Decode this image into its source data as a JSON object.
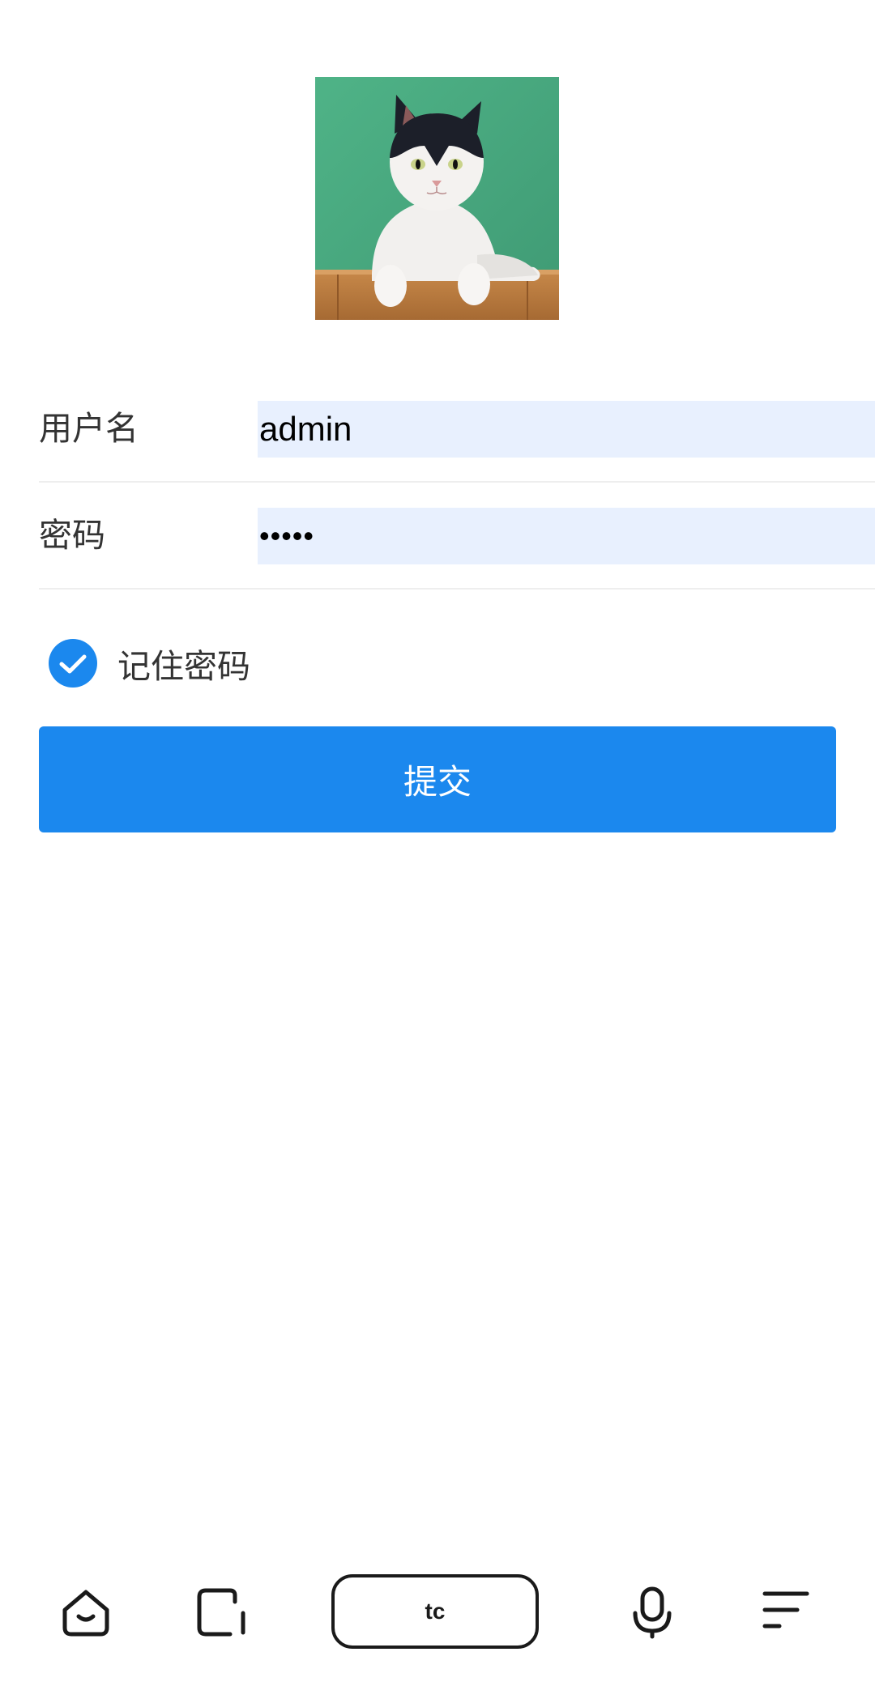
{
  "avatar": {
    "icon": "cat-photo"
  },
  "form": {
    "username": {
      "label": "用户名",
      "value": "admin"
    },
    "password": {
      "label": "密码",
      "value": "•••••"
    },
    "remember": {
      "label": "记住密码",
      "checked": true
    },
    "submit_label": "提交"
  },
  "bottom_bar": {
    "home_icon": "home-icon",
    "recent_icon": "recent-apps-icon",
    "center_label": "tc",
    "mic_icon": "microphone-icon",
    "menu_icon": "menu-icon"
  },
  "colors": {
    "primary": "#1b88ee",
    "input_bg": "#e8f0fe",
    "text": "#333333"
  }
}
